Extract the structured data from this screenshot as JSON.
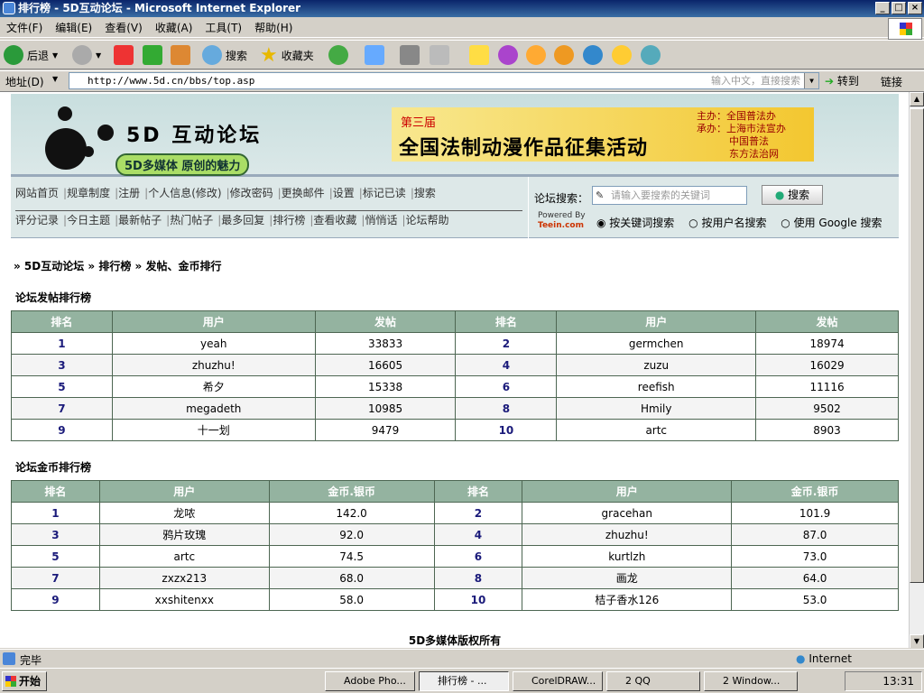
{
  "window": {
    "title": "排行榜 - 5D互动论坛 - Microsoft Internet Explorer"
  },
  "menu": [
    "文件(F)",
    "编辑(E)",
    "查看(V)",
    "收藏(A)",
    "工具(T)",
    "帮助(H)"
  ],
  "toolbar": {
    "back": "后退",
    "search": "搜索",
    "favorites": "收藏夹"
  },
  "address": {
    "label": "地址(D)",
    "url": "http://www.5d.cn/bbs/top.asp",
    "hint": "输入中文，直接搜索",
    "go": "转到",
    "links": "链接"
  },
  "banner": {
    "title": "5D 互动论坛",
    "subtitle": "5D多媒体 原创的魅力",
    "ad_edition": "第三届",
    "ad_main": "全国法制动漫作品征集活动",
    "ad_org": [
      "主办：全国普法办",
      "承办：上海市法宣办",
      "中国普法",
      "东方法治网"
    ]
  },
  "nav": {
    "row1": [
      "网站首页",
      "规章制度",
      "注册",
      "个人信息(修改)",
      "修改密码",
      "更换邮件",
      "设置",
      "标记已读",
      "搜索"
    ],
    "row2": [
      "评分记录",
      "今日主题",
      "最新帖子",
      "热门帖子",
      "最多回复",
      "排行榜",
      "查看收藏",
      "悄悄话",
      "论坛帮助"
    ]
  },
  "search": {
    "label": "论坛搜索：",
    "placeholder": "请输入要搜索的关键词",
    "button": "搜索",
    "powered_label": "Powered By",
    "powered_brand": "Teein.com",
    "options": [
      "按关键词搜索",
      "按用户名搜索",
      "使用 Google 搜索"
    ]
  },
  "breadcrumb": "» 5D互动论坛 » 排行榜 » 发帖、金币排行",
  "posts": {
    "title": "论坛发帖排行榜",
    "headers": [
      "排名",
      "用户",
      "发帖",
      "排名",
      "用户",
      "发帖"
    ],
    "rows": [
      [
        "1",
        "yeah",
        "33833",
        "2",
        "germchen",
        "18974"
      ],
      [
        "3",
        "zhuzhu!",
        "16605",
        "4",
        "zuzu",
        "16029"
      ],
      [
        "5",
        "希夕",
        "15338",
        "6",
        "reefish",
        "11116"
      ],
      [
        "7",
        "megadeth",
        "10985",
        "8",
        "Hmily",
        "9502"
      ],
      [
        "9",
        "十一划",
        "9479",
        "10",
        "artc",
        "8903"
      ]
    ]
  },
  "coins": {
    "title": "论坛金币排行榜",
    "headers": [
      "排名",
      "用户",
      "金币.银币",
      "排名",
      "用户",
      "金币.银币"
    ],
    "rows": [
      [
        "1",
        "龙哝",
        "142.0",
        "2",
        "gracehan",
        "101.9"
      ],
      [
        "3",
        "鸦片玫瑰",
        "92.0",
        "4",
        "zhuzhu!",
        "87.0"
      ],
      [
        "5",
        "artc",
        "74.5",
        "6",
        "kurtlzh",
        "73.0"
      ],
      [
        "7",
        "zxzx213",
        "68.0",
        "8",
        "画龙",
        "64.0"
      ],
      [
        "9",
        "xxshitenxx",
        "58.0",
        "10",
        "桔子香水126",
        "53.0"
      ]
    ]
  },
  "footer": "5D多媒体版权所有",
  "status": {
    "text": "完毕",
    "zone": "Internet"
  },
  "taskbar": {
    "start": "开始",
    "items": [
      "Adobe Pho...",
      "排行榜 - ...",
      "CorelDRAW...",
      "2 QQ",
      "2 Window..."
    ],
    "clock": "13:31"
  }
}
